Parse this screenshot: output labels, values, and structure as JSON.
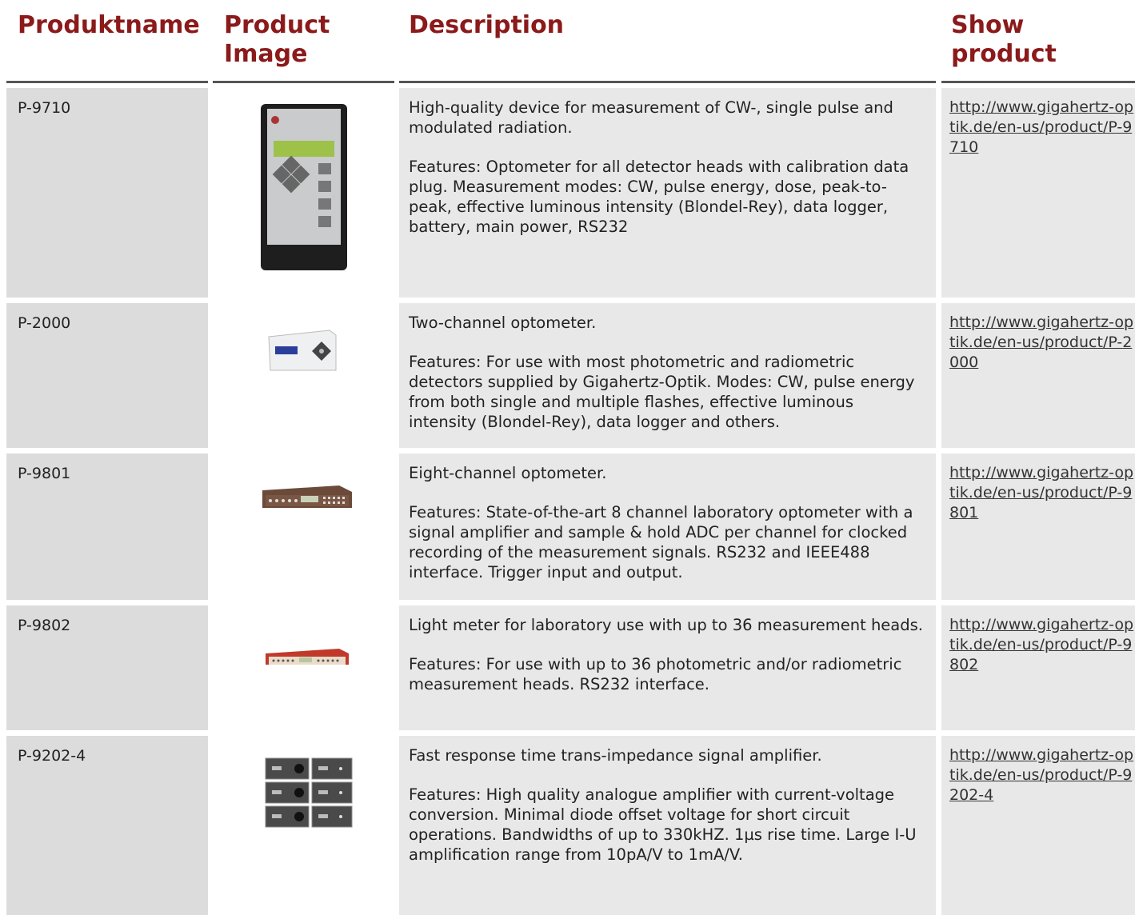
{
  "headers": [
    "Produktname",
    "Product Image",
    "Description",
    "Show product"
  ],
  "rows": [
    {
      "name": "P-9710",
      "desc1": "High-quality device for measurement of CW-, single pulse and modulated radiation.",
      "desc2": "Features: Optometer for all detector heads with calibration data plug. Measurement modes: CW, pulse energy, dose, peak-to-peak, effective luminous intensity (Blondel-Rey), data logger, battery, main power, RS232",
      "link": "http://www.gigahertz-optik.de/en-us/product/P-9710"
    },
    {
      "name": "P-2000",
      "desc1": "Two-channel optometer.",
      "desc2": "Features: For use with most photometric and radiometric detectors supplied by Gigahertz-Optik. Modes: CW, pulse energy from both single and multiple flashes, effective luminous intensity (Blondel-Rey), data logger and others.",
      "link": "http://www.gigahertz-optik.de/en-us/product/P-2000"
    },
    {
      "name": "P-9801",
      "desc1": "Eight-channel optometer.",
      "desc2": "Features: State-of-the-art 8 channel laboratory optometer with a signal amplifier and sample & hold ADC per channel for clocked recording of the measurement signals. RS232 and IEEE488 interface. Trigger input and output.",
      "link": "http://www.gigahertz-optik.de/en-us/product/P-9801"
    },
    {
      "name": "P-9802",
      "desc1": "Light meter for laboratory use with up to 36 measurement heads.",
      "desc2": "Features: For use with up to 36 photometric and/or radiometric measurement heads. RS232 interface.",
      "link": "http://www.gigahertz-optik.de/en-us/product/P-9802"
    },
    {
      "name": "P-9202-4",
      "desc1": "Fast response time trans-impedance signal amplifier.",
      "desc2": "Features: High quality analogue amplifier with current-voltage conversion. Minimal diode offset voltage for short circuit operations. Bandwidths of up to 330kHZ. 1µs rise time. Large I-U amplification range from 10pA/V to 1mA/V.",
      "link": "http://www.gigahertz-optik.de/en-us/product/P-9202-4"
    }
  ]
}
